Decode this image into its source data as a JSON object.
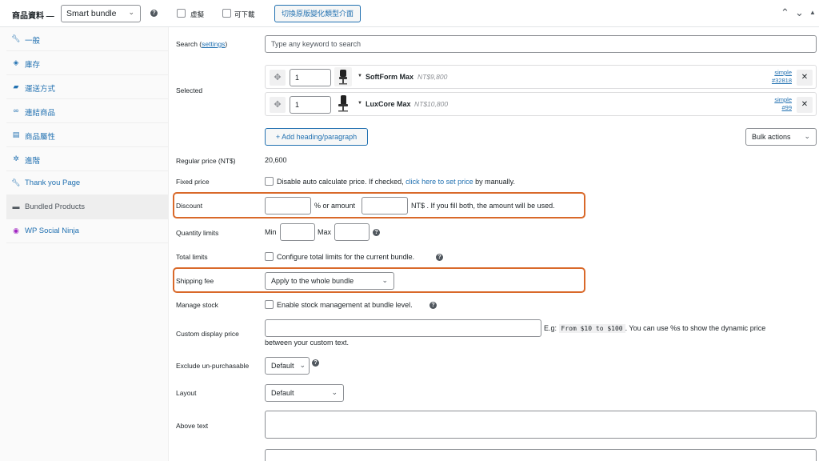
{
  "header": {
    "title": "商品資料 —",
    "product_type": "Smart bundle",
    "virtual_label": "虛擬",
    "downloadable_label": "可下載",
    "switch_button": "切換原版變化類型介面"
  },
  "sidebar": {
    "items": [
      {
        "label": "一般",
        "icon": "wrench-icon"
      },
      {
        "label": "庫存",
        "icon": "tag-icon"
      },
      {
        "label": "運送方式",
        "icon": "truck-icon"
      },
      {
        "label": "連結商品",
        "icon": "link-icon"
      },
      {
        "label": "商品屬性",
        "icon": "table-icon"
      },
      {
        "label": "進階",
        "icon": "gear-icon"
      },
      {
        "label": "Thank you Page",
        "icon": "wrench-icon"
      },
      {
        "label": "Bundled Products",
        "icon": "box-icon"
      },
      {
        "label": "WP Social Ninja",
        "icon": "ninja-icon"
      }
    ]
  },
  "form": {
    "search_label": "Search (",
    "search_settings_link": "settings",
    "search_label_close": ")",
    "search_placeholder": "Type any keyword to search",
    "selected_label": "Selected",
    "selected_items": [
      {
        "qty": "1",
        "name": "SoftForm Max",
        "price": "NT$9,800",
        "type": "simple",
        "id": "#32818"
      },
      {
        "qty": "1",
        "name": "LuxCore Max",
        "price": "NT$10,800",
        "type": "simple",
        "id": "#99"
      }
    ],
    "add_heading_button": "+ Add heading/paragraph",
    "bulk_actions": "Bulk actions",
    "regular_price_label": "Regular price (NT$)",
    "regular_price_value": "20,600",
    "fixed_price_label": "Fixed price",
    "fixed_price_text_a": "Disable auto calculate price. If checked, ",
    "fixed_price_link": "click here to set price",
    "fixed_price_text_b": " by manually.",
    "discount_label": "Discount",
    "discount_or_amount": "% or amount",
    "discount_note": "NT$ . If you fill both, the amount will be used.",
    "quantity_limits_label": "Quantity limits",
    "min_label": "Min",
    "max_label": "Max",
    "total_limits_label": "Total limits",
    "total_limits_text": "Configure total limits for the current bundle.",
    "shipping_fee_label": "Shipping fee",
    "shipping_fee_value": "Apply to the whole bundle",
    "manage_stock_label": "Manage stock",
    "manage_stock_text": "Enable stock management at bundle level.",
    "custom_display_price_label": "Custom display price",
    "custom_eg": "E.g:",
    "custom_code": "From $10 to $100",
    "custom_note_a": ". You can use %s to show the dynamic price",
    "custom_note_b": "between your custom text.",
    "exclude_label": "Exclude un-purchasable",
    "exclude_value": "Default",
    "layout_label": "Layout",
    "layout_value": "Default",
    "above_text_label": "Above text"
  },
  "colors": {
    "accent": "#2271b1",
    "highlight": "#d9692a"
  }
}
